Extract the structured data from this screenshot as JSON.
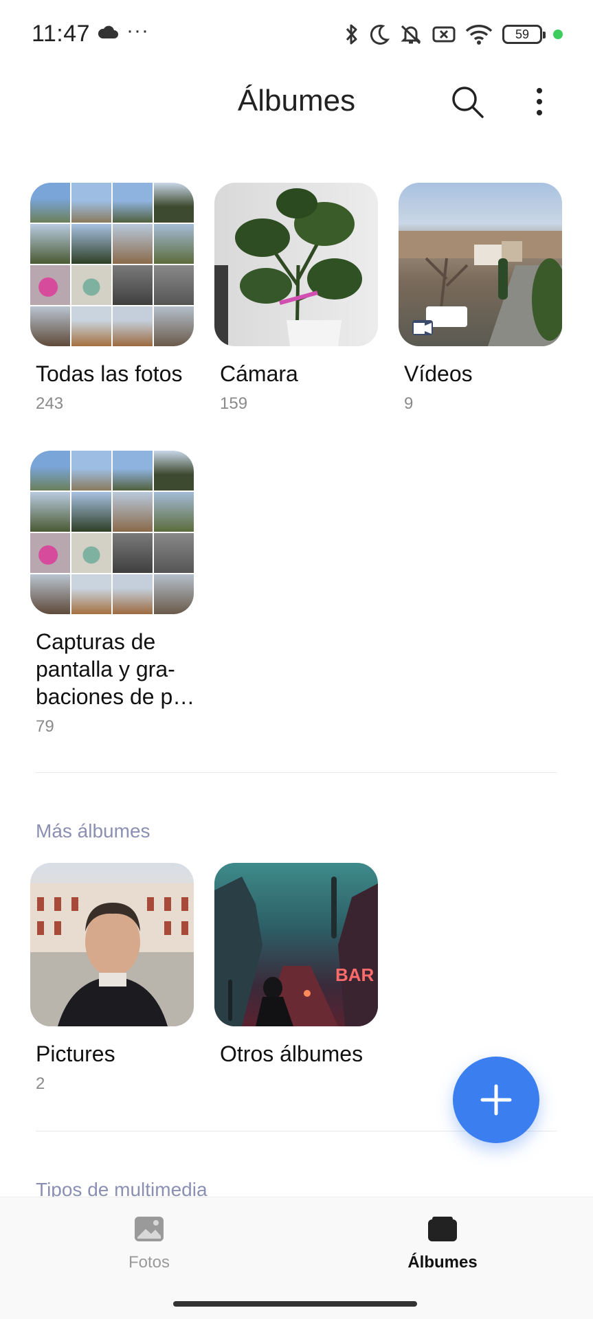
{
  "status_bar": {
    "time": "11:47",
    "dots": "···",
    "battery": "59",
    "icons": [
      "cloud-icon",
      "bluetooth-icon",
      "moon-icon",
      "mute-icon",
      "sim-off-icon",
      "wifi-icon",
      "battery-icon",
      "privacy-dot-icon"
    ]
  },
  "header": {
    "title": "Álbumes",
    "search_icon": "search-icon",
    "more_icon": "more-vert-icon"
  },
  "albums": [
    {
      "name": "Todas las fotos",
      "count": "243"
    },
    {
      "name": "Cámara",
      "count": "159"
    },
    {
      "name": "Vídeos",
      "count": "9"
    },
    {
      "name": "Capturas de pantalla y gra-baciones de p…",
      "line1": "Capturas de",
      "line2": "pantalla y gra-",
      "line3": "baciones de p…",
      "count": "79"
    }
  ],
  "more_section": {
    "label": "Más álbumes",
    "albums": [
      {
        "name": "Pictures",
        "count": "2"
      },
      {
        "name": "Otros álbumes"
      }
    ]
  },
  "media_types_label": "Tipos de multimedia",
  "bottom_nav": {
    "items": [
      {
        "label": "Fotos",
        "icon": "photo-icon",
        "active": false
      },
      {
        "label": "Álbumes",
        "icon": "album-folder-icon",
        "active": true
      }
    ]
  },
  "colors": {
    "accent": "#3b7ef0",
    "section_label": "#8b90b3",
    "count_text": "#8a8a8a"
  }
}
